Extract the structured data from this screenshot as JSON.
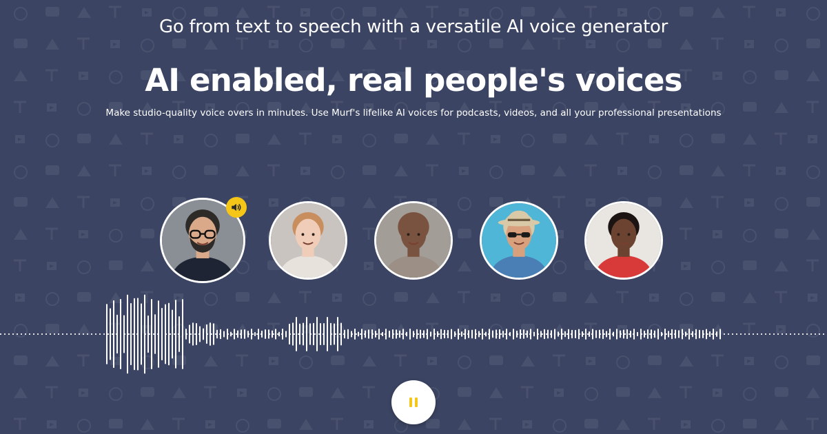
{
  "hero": {
    "subheading": "Go from text to speech with a versatile AI voice generator",
    "heading": "AI enabled, real people's voices",
    "tagline": "Make studio-quality voice overs in minutes. Use Murf's lifelike AI voices for podcasts, videos, and all your professional presentations"
  },
  "voices": [
    {
      "id": "voice-1",
      "active": true,
      "skin": "#d9a98a",
      "hair": "#2e2a28",
      "shirt": "#1e2433",
      "bg": "#8a8f96",
      "glasses": true,
      "beard": true
    },
    {
      "id": "voice-2",
      "active": false,
      "skin": "#efcdb8",
      "hair": "#c98e5e",
      "shirt": "#e8e2dc",
      "bg": "#c9c4c0"
    },
    {
      "id": "voice-3",
      "active": false,
      "skin": "#7a5340",
      "hair": "#7a5340",
      "shirt": "#9b8f86",
      "bg": "#a39d98"
    },
    {
      "id": "voice-4",
      "active": false,
      "skin": "#d8a07c",
      "hair": "#d8c9a8",
      "shirt": "#4a7fb5",
      "bg": "#4fb6d8",
      "hat": true,
      "sunglasses": true
    },
    {
      "id": "voice-5",
      "active": false,
      "skin": "#6b4330",
      "hair": "#1b1412",
      "shirt": "#d83a3a",
      "bg": "#e9e5e1"
    }
  ],
  "player": {
    "state": "playing",
    "control_icon": "pause-icon",
    "accent_color": "#f5c518",
    "speaker_icon": "speaker-icon"
  },
  "colors": {
    "background": "#3b4462",
    "text": "#ffffff",
    "accent": "#f5c518"
  }
}
